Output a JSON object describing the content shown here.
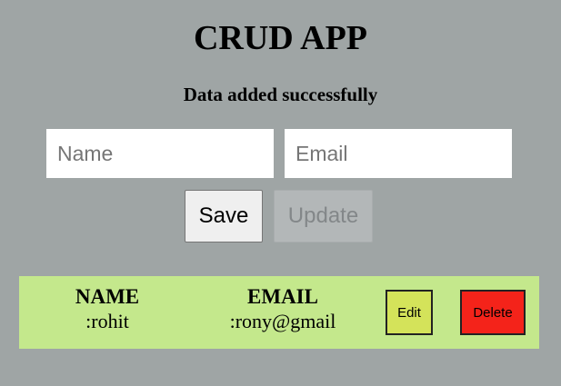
{
  "app": {
    "title": "CRUD APP",
    "status_message": "Data added successfully"
  },
  "form": {
    "name": {
      "value": "",
      "placeholder": "Name"
    },
    "email": {
      "value": "",
      "placeholder": "Email"
    },
    "save_label": "Save",
    "update_label": "Update"
  },
  "records": [
    {
      "name_header": "NAME",
      "name_value": ":rohit",
      "email_header": "EMAIL",
      "email_value": ":rony@gmail",
      "edit_label": "Edit",
      "delete_label": "Delete"
    }
  ],
  "colors": {
    "background": "#9fa5a5",
    "record_background": "#c4e88c",
    "edit_button": "#d4e35a",
    "delete_button": "#f4231a",
    "update_disabled": "#b3b7b8"
  }
}
